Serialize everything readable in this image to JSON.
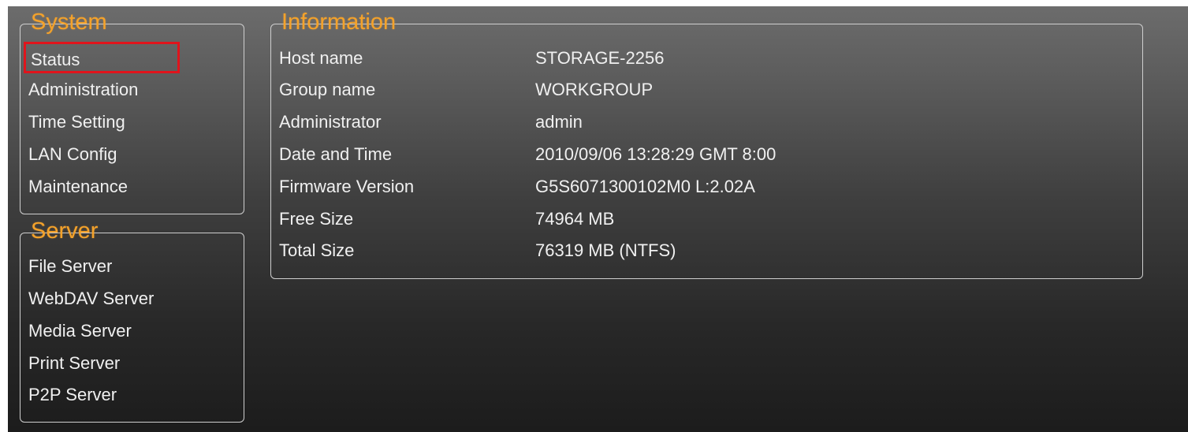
{
  "system_panel": {
    "title": "System",
    "items": [
      {
        "label": "Status",
        "selected": true
      },
      {
        "label": "Administration"
      },
      {
        "label": "Time Setting"
      },
      {
        "label": "LAN Config"
      },
      {
        "label": "Maintenance"
      }
    ]
  },
  "server_panel": {
    "title": "Server",
    "items": [
      {
        "label": "File Server"
      },
      {
        "label": "WebDAV Server"
      },
      {
        "label": "Media Server"
      },
      {
        "label": "Print Server"
      },
      {
        "label": "P2P Server"
      }
    ]
  },
  "information_panel": {
    "title": "Information",
    "rows": [
      {
        "label": "Host name",
        "value": "STORAGE-2256"
      },
      {
        "label": "Group name",
        "value": "WORKGROUP"
      },
      {
        "label": "Administrator",
        "value": "admin"
      },
      {
        "label": "Date and Time",
        "value": "2010/09/06 13:28:29 GMT 8:00"
      },
      {
        "label": "Firmware Version",
        "value": "G5S6071300102M0 L:2.02A"
      },
      {
        "label": "Free Size",
        "value": "74964 MB"
      },
      {
        "label": "Total Size",
        "value": "76319 MB (NTFS)"
      }
    ]
  },
  "colors": {
    "title_accent": "#f4a22a",
    "selection_border": "#e0141c",
    "text": "#f0f0f0"
  }
}
